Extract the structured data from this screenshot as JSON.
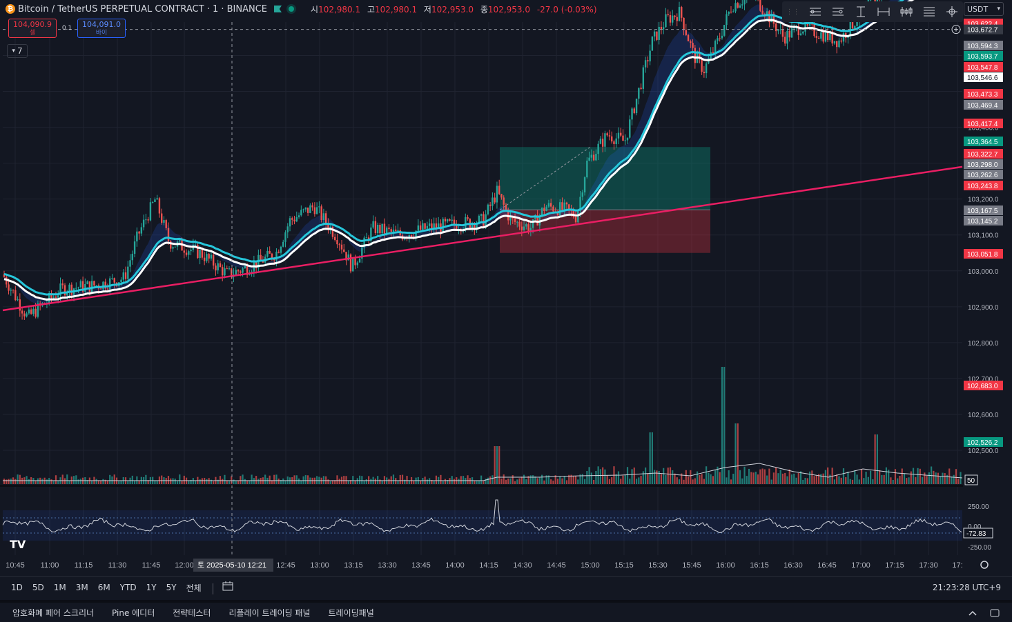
{
  "header": {
    "symbol": "Bitcoin / TetherUS PERPETUAL CONTRACT · 1 · BINANCE",
    "coin_icon": "bitcoin-icon",
    "open_label": "시",
    "open": "102,980.1",
    "high_label": "고",
    "high": "102,980.1",
    "low_label": "저",
    "low": "102,953.0",
    "close_label": "종",
    "close": "102,953.0",
    "change": "-27.0 (-0.03%)"
  },
  "trade": {
    "sell_price": "104,090.9",
    "sell_label": "셀",
    "spread": "0.1",
    "buy_price": "104,091.0",
    "buy_label": "바이"
  },
  "indicators_toggle": {
    "count": "7"
  },
  "currency": {
    "value": "USDT"
  },
  "drawing_tools": [
    "horizontal-ray-icon",
    "parallel-channel-icon",
    "price-range-icon",
    "date-range-icon",
    "long-position-icon",
    "fib-icon",
    "crosshair-settings-icon"
  ],
  "chart_data": {
    "type": "candlestick",
    "x_ticks": [
      "10:45",
      "11:00",
      "11:15",
      "11:30",
      "11:45",
      "12:00",
      "12:45",
      "13:00",
      "13:15",
      "13:30",
      "13:45",
      "14:00",
      "14:15",
      "14:30",
      "14:45",
      "15:00",
      "15:15",
      "15:30",
      "15:45",
      "16:00",
      "16:15",
      "16:30",
      "16:45",
      "17:00",
      "17:15",
      "17:30",
      "17:"
    ],
    "crosshair_date_label": "토 2025-05-10",
    "crosshair_time_label": "12:21",
    "y_ticks": [
      "102,500.0",
      "102,600.0",
      "102,700.0",
      "102,800.0",
      "102,900.0",
      "103,000.0",
      "103,100.0",
      "103,200.0",
      "103,300.0",
      "103,400.0",
      "103,500.0",
      "103,600.0"
    ],
    "ylim": [
      102450,
      103700
    ],
    "crosshair_price": "103,672.7",
    "price_labels": [
      {
        "value": "103,622.4",
        "color": "#f23645"
      },
      {
        "value": "103,594.3",
        "color": "#787b86"
      },
      {
        "value": "103,593.7",
        "color": "#089981"
      },
      {
        "value": "103,547.8",
        "color": "#f23645"
      },
      {
        "value": "103,546.6",
        "color": "#ffffff"
      },
      {
        "value": "103,473.3",
        "color": "#f23645"
      },
      {
        "value": "103,469.4",
        "color": "#787b86"
      },
      {
        "value": "103,417.4",
        "color": "#f23645"
      },
      {
        "value": "103,364.5",
        "color": "#089981"
      },
      {
        "value": "103,322.7",
        "color": "#f23645"
      },
      {
        "value": "103,298.0",
        "color": "#787b86"
      },
      {
        "value": "103,262.6",
        "color": "#787b86"
      },
      {
        "value": "103,243.8",
        "color": "#f23645"
      },
      {
        "value": "103,167.5",
        "color": "#787b86"
      },
      {
        "value": "103,145.2",
        "color": "#787b86"
      },
      {
        "value": "103,051.8",
        "color": "#f23645"
      },
      {
        "value": "102,683.0",
        "color": "#f23645"
      },
      {
        "value": "102,526.2",
        "color": "#089981"
      }
    ],
    "trendline": {
      "start": [
        0,
        102890
      ],
      "end": [
        1,
        103290
      ],
      "color": "#e91e63"
    },
    "position": {
      "type": "long",
      "entry": 103170,
      "target": 103345,
      "stop": 103050
    },
    "volume_ma_label": "50",
    "oscillator": {
      "ticks": [
        "250.00",
        "0.00",
        "-250.00"
      ],
      "current": "-72.83"
    },
    "colors": {
      "up": "#26a69a",
      "down": "#ef5350",
      "ma_white": "#ffffff",
      "ma_cyan": "#26c6da"
    }
  },
  "bottom_bar": {
    "ranges": [
      "1D",
      "5D",
      "1M",
      "3M",
      "6M",
      "YTD",
      "1Y",
      "5Y",
      "전체"
    ],
    "clock": "21:23:28 UTC+9"
  },
  "panel_tabs": [
    "암호화폐 페어 스크리너",
    "Pine 에디터",
    "전략테스터",
    "리플레이 트레이딩 패널",
    "트레이딩패널"
  ],
  "logo": "TV"
}
